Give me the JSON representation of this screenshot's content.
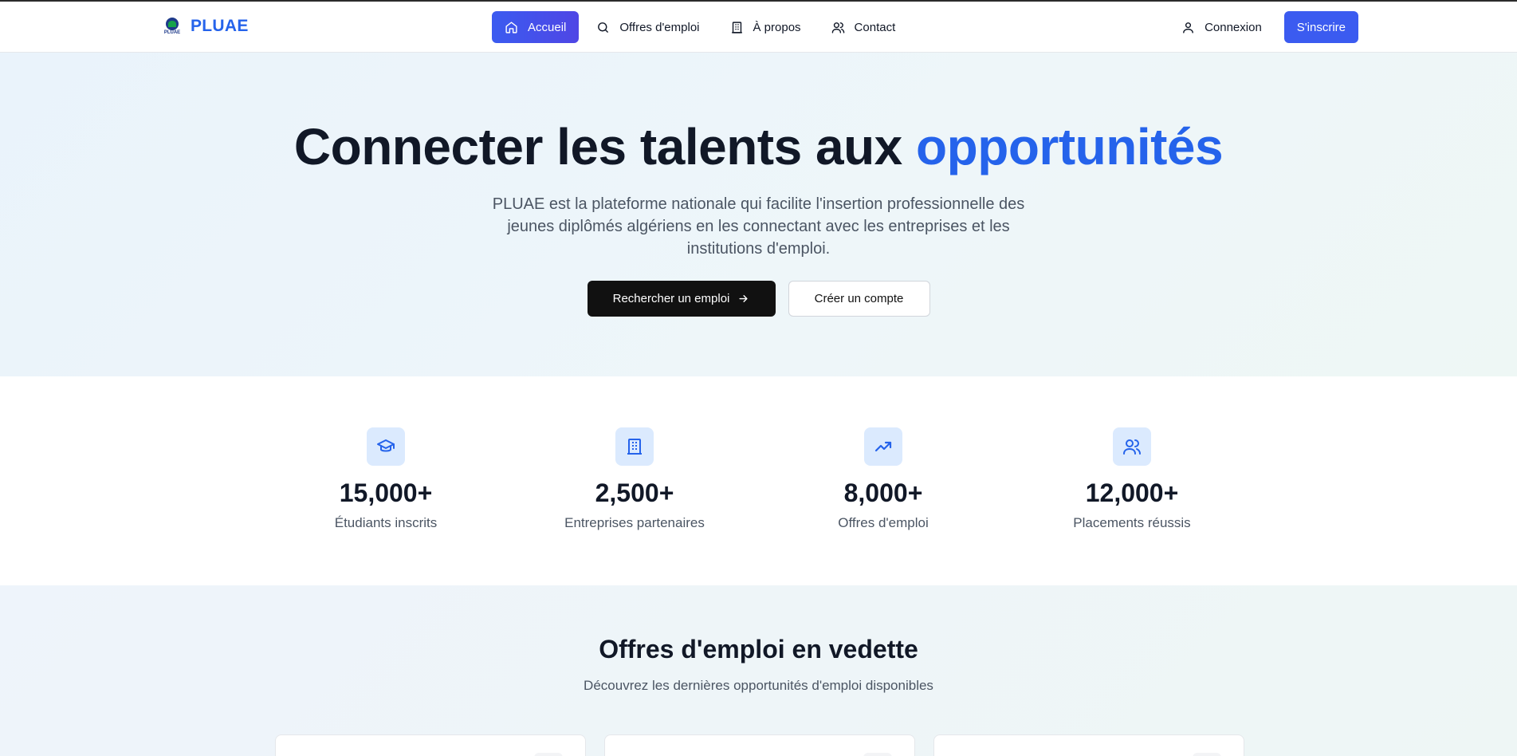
{
  "brand": {
    "name": "PLUAE",
    "logo_text": "PLUAE"
  },
  "nav": {
    "items": [
      {
        "label": "Accueil",
        "icon": "home-icon"
      },
      {
        "label": "Offres d'emploi",
        "icon": "search-icon"
      },
      {
        "label": "À propos",
        "icon": "building-icon"
      },
      {
        "label": "Contact",
        "icon": "users-icon"
      }
    ]
  },
  "auth": {
    "login_label": "Connexion",
    "signup_label": "S'inscrire"
  },
  "hero": {
    "title_main": "Connecter les talents aux ",
    "title_accent": "opportunités",
    "description": "PLUAE est la plateforme nationale qui facilite l'insertion professionnelle des jeunes diplômés algériens en les connectant avec les entreprises et les institutions d'emploi.",
    "primary_cta": "Rechercher un emploi",
    "secondary_cta": "Créer un compte"
  },
  "stats": [
    {
      "value": "15,000+",
      "label": "Étudiants inscrits",
      "icon": "graduation-cap-icon"
    },
    {
      "value": "2,500+",
      "label": "Entreprises partenaires",
      "icon": "building-icon"
    },
    {
      "value": "8,000+",
      "label": "Offres d'emploi",
      "icon": "trending-up-icon"
    },
    {
      "value": "12,000+",
      "label": "Placements réussis",
      "icon": "users-icon"
    }
  ],
  "featured": {
    "title": "Offres d'emploi en vedette",
    "subtitle": "Découvrez les dernières opportunités d'emploi disponibles"
  },
  "colors": {
    "accent": "#2563eb",
    "nav_active": "#4f46e5",
    "icon_bg": "#dbeafe"
  }
}
